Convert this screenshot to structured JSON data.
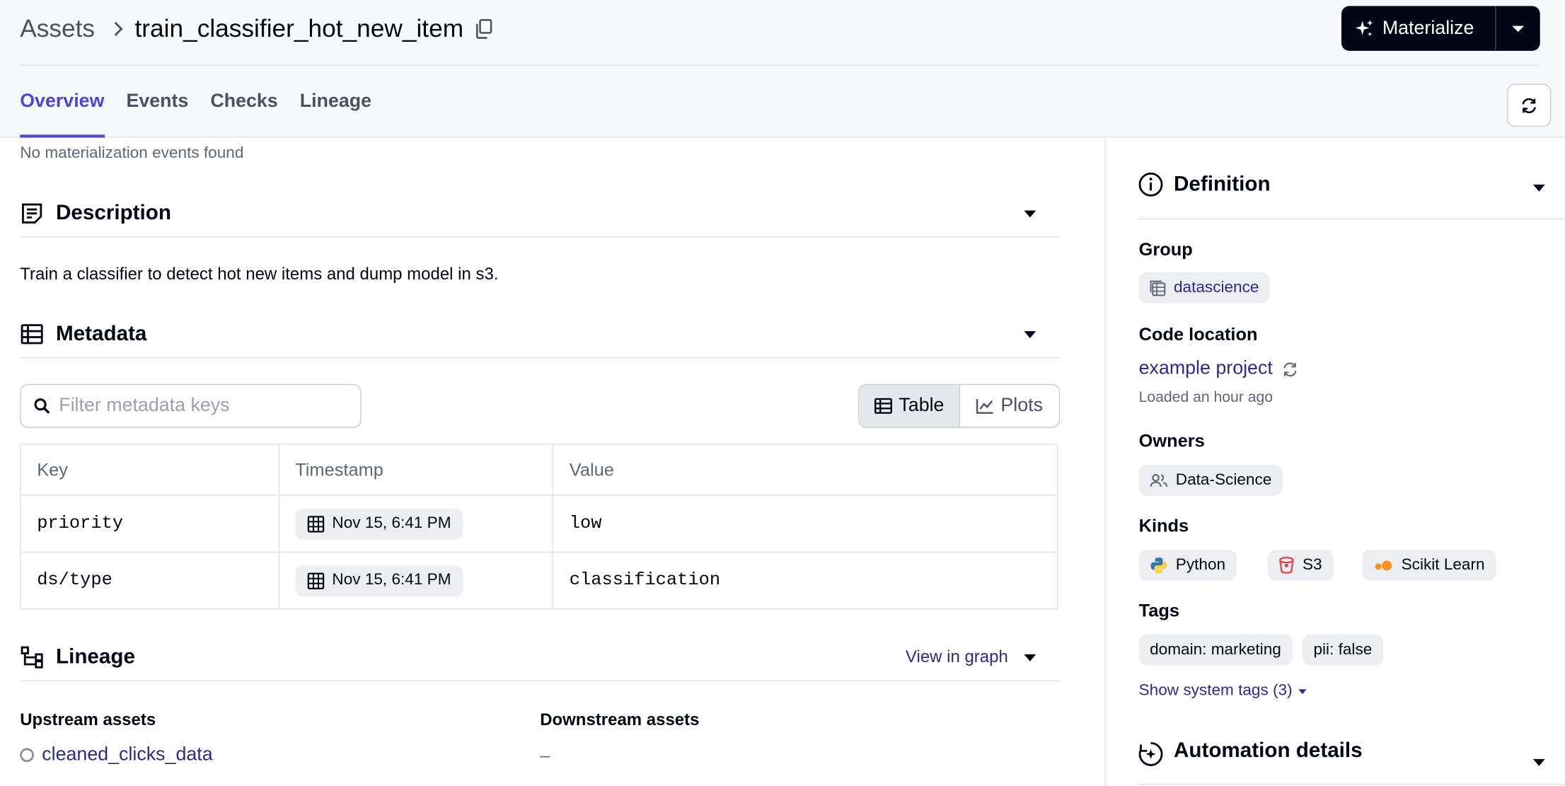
{
  "header": {
    "breadcrumb_root": "Assets",
    "asset_name": "train_classifier_hot_new_item",
    "materialize_label": "Materialize"
  },
  "tabs": [
    {
      "label": "Overview",
      "active": true
    },
    {
      "label": "Events",
      "active": false
    },
    {
      "label": "Checks",
      "active": false
    },
    {
      "label": "Lineage",
      "active": false
    }
  ],
  "overview": {
    "no_events": "No materialization events found",
    "description": {
      "title": "Description",
      "text": "Train a classifier to detect hot new items and dump model in s3."
    },
    "metadata": {
      "title": "Metadata",
      "filter_placeholder": "Filter metadata keys",
      "view_table_label": "Table",
      "view_plots_label": "Plots",
      "columns": [
        "Key",
        "Timestamp",
        "Value"
      ],
      "rows": [
        {
          "key": "priority",
          "timestamp": "Nov 15, 6:41 PM",
          "value": "low"
        },
        {
          "key": "ds/type",
          "timestamp": "Nov 15, 6:41 PM",
          "value": "classification"
        }
      ]
    },
    "lineage": {
      "title": "Lineage",
      "view_in_graph": "View in graph",
      "upstream_title": "Upstream assets",
      "upstream": [
        "cleaned_clicks_data"
      ],
      "downstream_title": "Downstream assets",
      "downstream_empty": "–"
    }
  },
  "definition": {
    "title": "Definition",
    "group_label": "Group",
    "group": "datascience",
    "code_location_label": "Code location",
    "code_location": "example project",
    "loaded": "Loaded an hour ago",
    "owners_label": "Owners",
    "owner": "Data-Science",
    "kinds_label": "Kinds",
    "kinds": [
      "Python",
      "S3",
      "Scikit Learn"
    ],
    "tags_label": "Tags",
    "tags": [
      "domain: marketing",
      "pii: false"
    ],
    "show_system_tags": "Show system tags (3)"
  },
  "automation": {
    "title": "Automation details"
  },
  "colors": {
    "accent": "#4f43dd",
    "link": "#2d2a8e",
    "primary_button": "#030615"
  }
}
